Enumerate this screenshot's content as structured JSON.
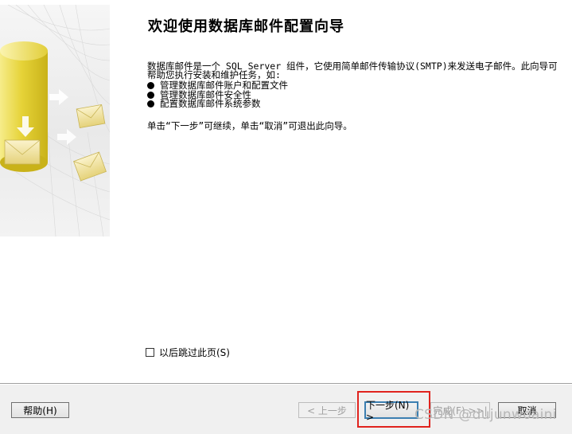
{
  "wizard": {
    "title": "欢迎使用数据库邮件配置向导",
    "intro": "数据库邮件是一个 SQL Server 组件，它使用简单邮件传输协议(SMTP)来发送电子邮件。此向导可帮助您执行安装和维护任务，如:",
    "bullets": [
      "管理数据库邮件账户和配置文件",
      "管理数据库邮件安全性",
      "配置数据库邮件系统参数"
    ],
    "hint": "单击“下一步”可继续，单击“取消”可退出此向导。",
    "skip_label": "以后跳过此页(S)",
    "skip_checked": false
  },
  "footer": {
    "help": "帮助(H)",
    "back": "< 上一步",
    "next": "下一步(N) >",
    "finish": "完成(F) >>|",
    "cancel": "取消"
  },
  "watermark": "CSDN @dujunwoaini",
  "colors": {
    "highlight": "#e0231e",
    "cylinder": "#e8d94a",
    "default_border": "#3c7fb1"
  }
}
